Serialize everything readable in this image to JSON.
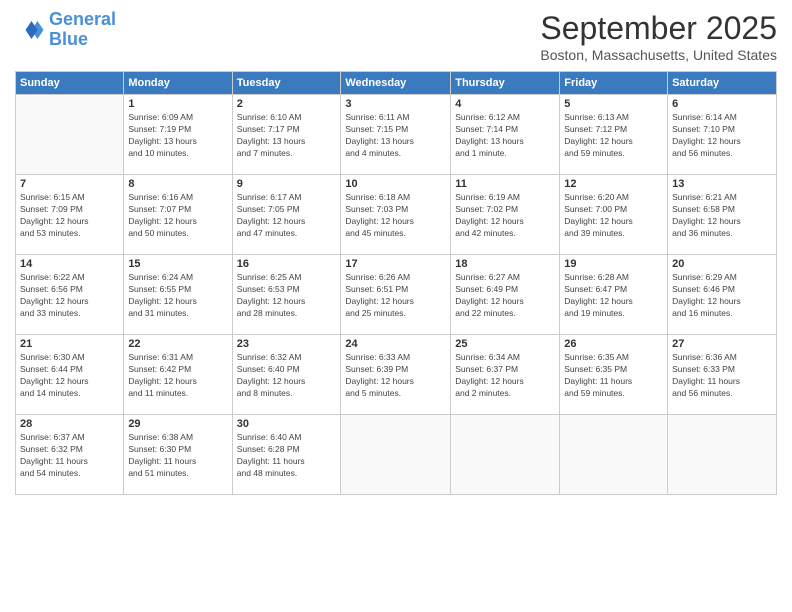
{
  "logo": {
    "line1": "General",
    "line2": "Blue"
  },
  "title": "September 2025",
  "subtitle": "Boston, Massachusetts, United States",
  "days_of_week": [
    "Sunday",
    "Monday",
    "Tuesday",
    "Wednesday",
    "Thursday",
    "Friday",
    "Saturday"
  ],
  "weeks": [
    [
      {
        "day": "",
        "detail": ""
      },
      {
        "day": "1",
        "detail": "Sunrise: 6:09 AM\nSunset: 7:19 PM\nDaylight: 13 hours\nand 10 minutes."
      },
      {
        "day": "2",
        "detail": "Sunrise: 6:10 AM\nSunset: 7:17 PM\nDaylight: 13 hours\nand 7 minutes."
      },
      {
        "day": "3",
        "detail": "Sunrise: 6:11 AM\nSunset: 7:15 PM\nDaylight: 13 hours\nand 4 minutes."
      },
      {
        "day": "4",
        "detail": "Sunrise: 6:12 AM\nSunset: 7:14 PM\nDaylight: 13 hours\nand 1 minute."
      },
      {
        "day": "5",
        "detail": "Sunrise: 6:13 AM\nSunset: 7:12 PM\nDaylight: 12 hours\nand 59 minutes."
      },
      {
        "day": "6",
        "detail": "Sunrise: 6:14 AM\nSunset: 7:10 PM\nDaylight: 12 hours\nand 56 minutes."
      }
    ],
    [
      {
        "day": "7",
        "detail": "Sunrise: 6:15 AM\nSunset: 7:09 PM\nDaylight: 12 hours\nand 53 minutes."
      },
      {
        "day": "8",
        "detail": "Sunrise: 6:16 AM\nSunset: 7:07 PM\nDaylight: 12 hours\nand 50 minutes."
      },
      {
        "day": "9",
        "detail": "Sunrise: 6:17 AM\nSunset: 7:05 PM\nDaylight: 12 hours\nand 47 minutes."
      },
      {
        "day": "10",
        "detail": "Sunrise: 6:18 AM\nSunset: 7:03 PM\nDaylight: 12 hours\nand 45 minutes."
      },
      {
        "day": "11",
        "detail": "Sunrise: 6:19 AM\nSunset: 7:02 PM\nDaylight: 12 hours\nand 42 minutes."
      },
      {
        "day": "12",
        "detail": "Sunrise: 6:20 AM\nSunset: 7:00 PM\nDaylight: 12 hours\nand 39 minutes."
      },
      {
        "day": "13",
        "detail": "Sunrise: 6:21 AM\nSunset: 6:58 PM\nDaylight: 12 hours\nand 36 minutes."
      }
    ],
    [
      {
        "day": "14",
        "detail": "Sunrise: 6:22 AM\nSunset: 6:56 PM\nDaylight: 12 hours\nand 33 minutes."
      },
      {
        "day": "15",
        "detail": "Sunrise: 6:24 AM\nSunset: 6:55 PM\nDaylight: 12 hours\nand 31 minutes."
      },
      {
        "day": "16",
        "detail": "Sunrise: 6:25 AM\nSunset: 6:53 PM\nDaylight: 12 hours\nand 28 minutes."
      },
      {
        "day": "17",
        "detail": "Sunrise: 6:26 AM\nSunset: 6:51 PM\nDaylight: 12 hours\nand 25 minutes."
      },
      {
        "day": "18",
        "detail": "Sunrise: 6:27 AM\nSunset: 6:49 PM\nDaylight: 12 hours\nand 22 minutes."
      },
      {
        "day": "19",
        "detail": "Sunrise: 6:28 AM\nSunset: 6:47 PM\nDaylight: 12 hours\nand 19 minutes."
      },
      {
        "day": "20",
        "detail": "Sunrise: 6:29 AM\nSunset: 6:46 PM\nDaylight: 12 hours\nand 16 minutes."
      }
    ],
    [
      {
        "day": "21",
        "detail": "Sunrise: 6:30 AM\nSunset: 6:44 PM\nDaylight: 12 hours\nand 14 minutes."
      },
      {
        "day": "22",
        "detail": "Sunrise: 6:31 AM\nSunset: 6:42 PM\nDaylight: 12 hours\nand 11 minutes."
      },
      {
        "day": "23",
        "detail": "Sunrise: 6:32 AM\nSunset: 6:40 PM\nDaylight: 12 hours\nand 8 minutes."
      },
      {
        "day": "24",
        "detail": "Sunrise: 6:33 AM\nSunset: 6:39 PM\nDaylight: 12 hours\nand 5 minutes."
      },
      {
        "day": "25",
        "detail": "Sunrise: 6:34 AM\nSunset: 6:37 PM\nDaylight: 12 hours\nand 2 minutes."
      },
      {
        "day": "26",
        "detail": "Sunrise: 6:35 AM\nSunset: 6:35 PM\nDaylight: 11 hours\nand 59 minutes."
      },
      {
        "day": "27",
        "detail": "Sunrise: 6:36 AM\nSunset: 6:33 PM\nDaylight: 11 hours\nand 56 minutes."
      }
    ],
    [
      {
        "day": "28",
        "detail": "Sunrise: 6:37 AM\nSunset: 6:32 PM\nDaylight: 11 hours\nand 54 minutes."
      },
      {
        "day": "29",
        "detail": "Sunrise: 6:38 AM\nSunset: 6:30 PM\nDaylight: 11 hours\nand 51 minutes."
      },
      {
        "day": "30",
        "detail": "Sunrise: 6:40 AM\nSunset: 6:28 PM\nDaylight: 11 hours\nand 48 minutes."
      },
      {
        "day": "",
        "detail": ""
      },
      {
        "day": "",
        "detail": ""
      },
      {
        "day": "",
        "detail": ""
      },
      {
        "day": "",
        "detail": ""
      }
    ]
  ]
}
